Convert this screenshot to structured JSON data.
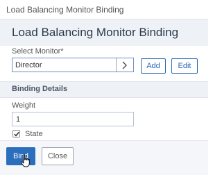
{
  "window": {
    "title": "Load Balancing Monitor Binding"
  },
  "header": {
    "title": "Load Balancing Monitor Binding"
  },
  "monitor": {
    "label": "Select Monitor*",
    "value": "Director",
    "add_label": "Add",
    "edit_label": "Edit"
  },
  "binding": {
    "section_title": "Binding Details",
    "weight_label": "Weight",
    "weight_value": "1",
    "state_label": "State",
    "state_checked": true
  },
  "footer": {
    "bind_label": "Bind",
    "close_label": "Close"
  },
  "colors": {
    "primary": "#2a6ebc",
    "header_bg": "#eef2f7",
    "footer_bg": "#f4f6f9"
  }
}
